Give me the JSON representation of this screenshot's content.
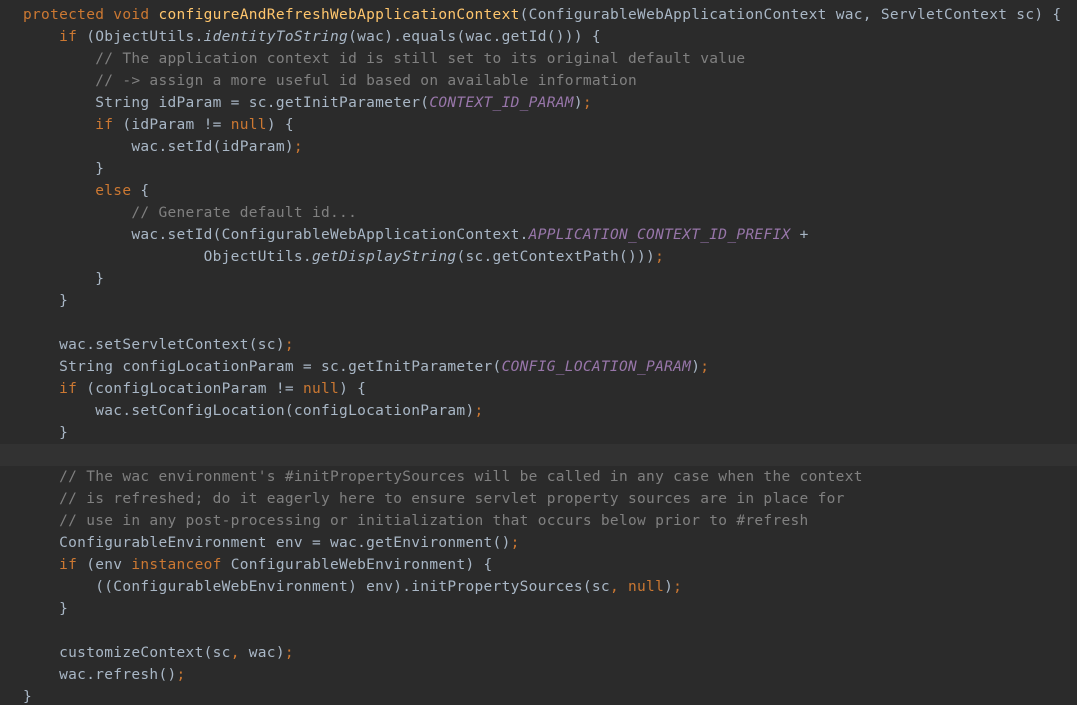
{
  "editor": {
    "theme": {
      "background": "#2b2b2b",
      "current_line": "#323232",
      "text": "#a9b7c6",
      "keyword": "#cc7832",
      "method_declaration": "#ffc66d",
      "comment": "#808080",
      "constant": "#9876aa"
    },
    "lines": [
      {
        "tokens": [
          {
            "t": "kw",
            "v": "protected void "
          },
          {
            "t": "fn",
            "v": "configureAndRefreshWebApplicationContext"
          },
          {
            "t": "",
            "v": "(ConfigurableWebApplicationContext wac, ServletContext sc) {"
          }
        ]
      },
      {
        "tokens": [
          {
            "t": "",
            "v": "    "
          },
          {
            "t": "kw",
            "v": "if "
          },
          {
            "t": "",
            "v": "(ObjectUtils."
          },
          {
            "t": "st",
            "v": "identityToString"
          },
          {
            "t": "",
            "v": "(wac).equals(wac.getId())) {"
          }
        ]
      },
      {
        "tokens": [
          {
            "t": "cm",
            "v": "        // The application context id is still set to its original default value"
          }
        ]
      },
      {
        "tokens": [
          {
            "t": "cm",
            "v": "        // -> assign a more useful id based on available information"
          }
        ]
      },
      {
        "tokens": [
          {
            "t": "",
            "v": "        String idParam = sc.getInitParameter("
          },
          {
            "t": "ct",
            "v": "CONTEXT_ID_PARAM"
          },
          {
            "t": "",
            "v": ")"
          },
          {
            "t": "sc",
            "v": ";"
          }
        ]
      },
      {
        "tokens": [
          {
            "t": "",
            "v": "        "
          },
          {
            "t": "kw",
            "v": "if "
          },
          {
            "t": "",
            "v": "(idParam != "
          },
          {
            "t": "kw",
            "v": "null"
          },
          {
            "t": "",
            "v": ") {"
          }
        ]
      },
      {
        "tokens": [
          {
            "t": "",
            "v": "            wac.setId(idParam)"
          },
          {
            "t": "sc",
            "v": ";"
          }
        ]
      },
      {
        "tokens": [
          {
            "t": "",
            "v": "        }"
          }
        ]
      },
      {
        "tokens": [
          {
            "t": "",
            "v": "        "
          },
          {
            "t": "kw",
            "v": "else "
          },
          {
            "t": "",
            "v": "{"
          }
        ]
      },
      {
        "tokens": [
          {
            "t": "cm",
            "v": "            // Generate default id..."
          }
        ]
      },
      {
        "tokens": [
          {
            "t": "",
            "v": "            wac.setId(ConfigurableWebApplicationContext."
          },
          {
            "t": "ct",
            "v": "APPLICATION_CONTEXT_ID_PREFIX"
          },
          {
            "t": "",
            "v": " +"
          }
        ]
      },
      {
        "tokens": [
          {
            "t": "",
            "v": "                    ObjectUtils."
          },
          {
            "t": "st",
            "v": "getDisplayString"
          },
          {
            "t": "",
            "v": "(sc.getContextPath()))"
          },
          {
            "t": "sc",
            "v": ";"
          }
        ]
      },
      {
        "tokens": [
          {
            "t": "",
            "v": "        }"
          }
        ]
      },
      {
        "tokens": [
          {
            "t": "",
            "v": "    }"
          }
        ]
      },
      {
        "tokens": []
      },
      {
        "tokens": [
          {
            "t": "",
            "v": "    wac.setServletContext(sc)"
          },
          {
            "t": "sc",
            "v": ";"
          }
        ]
      },
      {
        "tokens": [
          {
            "t": "",
            "v": "    String configLocationParam = sc.getInitParameter("
          },
          {
            "t": "ct",
            "v": "CONFIG_LOCATION_PARAM"
          },
          {
            "t": "",
            "v": ")"
          },
          {
            "t": "sc",
            "v": ";"
          }
        ]
      },
      {
        "tokens": [
          {
            "t": "",
            "v": "    "
          },
          {
            "t": "kw",
            "v": "if "
          },
          {
            "t": "",
            "v": "(configLocationParam != "
          },
          {
            "t": "kw",
            "v": "null"
          },
          {
            "t": "",
            "v": ") {"
          }
        ]
      },
      {
        "tokens": [
          {
            "t": "",
            "v": "        wac.setConfigLocation(configLocationParam)"
          },
          {
            "t": "sc",
            "v": ";"
          }
        ]
      },
      {
        "tokens": [
          {
            "t": "",
            "v": "    }"
          }
        ]
      },
      {
        "tokens": [],
        "current": true
      },
      {
        "tokens": [
          {
            "t": "cm",
            "v": "    // The wac environment's #initPropertySources will be called in any case when the context"
          }
        ]
      },
      {
        "tokens": [
          {
            "t": "cm",
            "v": "    // is refreshed; do it eagerly here to ensure servlet property sources are in place for"
          }
        ]
      },
      {
        "tokens": [
          {
            "t": "cm",
            "v": "    // use in any post-processing or initialization that occurs below prior to #refresh"
          }
        ]
      },
      {
        "tokens": [
          {
            "t": "",
            "v": "    ConfigurableEnvironment env = wac.getEnvironment()"
          },
          {
            "t": "sc",
            "v": ";"
          }
        ]
      },
      {
        "tokens": [
          {
            "t": "",
            "v": "    "
          },
          {
            "t": "kw",
            "v": "if "
          },
          {
            "t": "",
            "v": "(env "
          },
          {
            "t": "kw",
            "v": "instanceof "
          },
          {
            "t": "",
            "v": "ConfigurableWebEnvironment) {"
          }
        ]
      },
      {
        "tokens": [
          {
            "t": "",
            "v": "        ((ConfigurableWebEnvironment) env).initPropertySources(sc"
          },
          {
            "t": "sc",
            "v": ", "
          },
          {
            "t": "kw",
            "v": "null"
          },
          {
            "t": "",
            "v": ")"
          },
          {
            "t": "sc",
            "v": ";"
          }
        ]
      },
      {
        "tokens": [
          {
            "t": "",
            "v": "    }"
          }
        ]
      },
      {
        "tokens": []
      },
      {
        "tokens": [
          {
            "t": "",
            "v": "    customizeContext(sc"
          },
          {
            "t": "sc",
            "v": ", "
          },
          {
            "t": "",
            "v": "wac)"
          },
          {
            "t": "sc",
            "v": ";"
          }
        ]
      },
      {
        "tokens": [
          {
            "t": "",
            "v": "    wac.refresh()"
          },
          {
            "t": "sc",
            "v": ";"
          }
        ]
      },
      {
        "tokens": [
          {
            "t": "",
            "v": "}"
          }
        ]
      }
    ]
  }
}
